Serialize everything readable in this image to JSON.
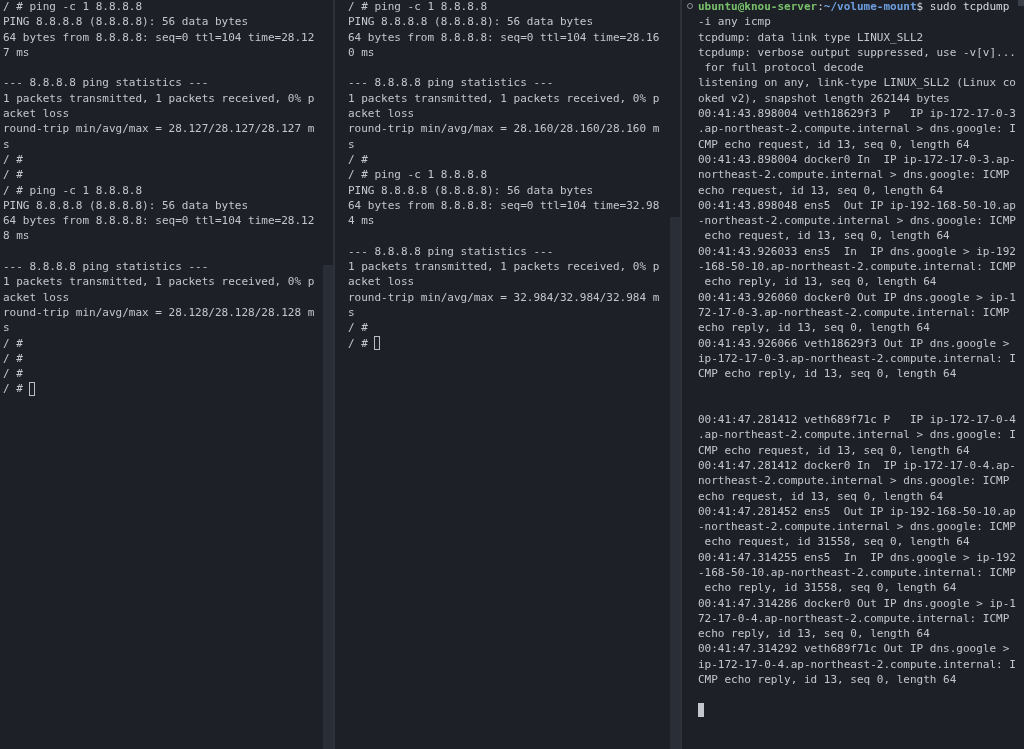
{
  "panes": [
    {
      "focused": false,
      "lines": [
        {
          "kind": "text",
          "text": "/ # ping -c 1 8.8.8.8"
        },
        {
          "kind": "text",
          "text": "PING 8.8.8.8 (8.8.8.8): 56 data bytes"
        },
        {
          "kind": "text",
          "text": "64 bytes from 8.8.8.8: seq=0 ttl=104 time=28.12"
        },
        {
          "kind": "text",
          "text": "7 ms"
        },
        {
          "kind": "blank"
        },
        {
          "kind": "text",
          "text": "--- 8.8.8.8 ping statistics ---"
        },
        {
          "kind": "text",
          "text": "1 packets transmitted, 1 packets received, 0% p"
        },
        {
          "kind": "text",
          "text": "acket loss"
        },
        {
          "kind": "text",
          "text": "round-trip min/avg/max = 28.127/28.127/28.127 m"
        },
        {
          "kind": "text",
          "text": "s"
        },
        {
          "kind": "text",
          "text": "/ #"
        },
        {
          "kind": "text",
          "text": "/ #"
        },
        {
          "kind": "text",
          "text": "/ # ping -c 1 8.8.8.8"
        },
        {
          "kind": "text",
          "text": "PING 8.8.8.8 (8.8.8.8): 56 data bytes"
        },
        {
          "kind": "text",
          "text": "64 bytes from 8.8.8.8: seq=0 ttl=104 time=28.12"
        },
        {
          "kind": "text",
          "text": "8 ms"
        },
        {
          "kind": "blank"
        },
        {
          "kind": "text",
          "text": "--- 8.8.8.8 ping statistics ---"
        },
        {
          "kind": "text",
          "text": "1 packets transmitted, 1 packets received, 0% p"
        },
        {
          "kind": "text",
          "text": "acket loss"
        },
        {
          "kind": "text",
          "text": "round-trip min/avg/max = 28.128/28.128/28.128 m"
        },
        {
          "kind": "text",
          "text": "s"
        },
        {
          "kind": "text",
          "text": "/ #"
        },
        {
          "kind": "text",
          "text": "/ #"
        },
        {
          "kind": "text",
          "text": "/ #"
        },
        {
          "kind": "input",
          "text": "/ #"
        }
      ]
    },
    {
      "focused": false,
      "lines": [
        {
          "kind": "text",
          "text": "/ # ping -c 1 8.8.8.8"
        },
        {
          "kind": "text",
          "text": "PING 8.8.8.8 (8.8.8.8): 56 data bytes"
        },
        {
          "kind": "text",
          "text": "64 bytes from 8.8.8.8: seq=0 ttl=104 time=28.16"
        },
        {
          "kind": "text",
          "text": "0 ms"
        },
        {
          "kind": "blank"
        },
        {
          "kind": "text",
          "text": "--- 8.8.8.8 ping statistics ---"
        },
        {
          "kind": "text",
          "text": "1 packets transmitted, 1 packets received, 0% p"
        },
        {
          "kind": "text",
          "text": "acket loss"
        },
        {
          "kind": "text",
          "text": "round-trip min/avg/max = 28.160/28.160/28.160 m"
        },
        {
          "kind": "text",
          "text": "s"
        },
        {
          "kind": "text",
          "text": "/ #"
        },
        {
          "kind": "text",
          "text": "/ # ping -c 1 8.8.8.8"
        },
        {
          "kind": "text",
          "text": "PING 8.8.8.8 (8.8.8.8): 56 data bytes"
        },
        {
          "kind": "text",
          "text": "64 bytes from 8.8.8.8: seq=0 ttl=104 time=32.98"
        },
        {
          "kind": "text",
          "text": "4 ms"
        },
        {
          "kind": "blank"
        },
        {
          "kind": "text",
          "text": "--- 8.8.8.8 ping statistics ---"
        },
        {
          "kind": "text",
          "text": "1 packets transmitted, 1 packets received, 0% p"
        },
        {
          "kind": "text",
          "text": "acket loss"
        },
        {
          "kind": "text",
          "text": "round-trip min/avg/max = 32.984/32.984/32.984 m"
        },
        {
          "kind": "text",
          "text": "s"
        },
        {
          "kind": "text",
          "text": "/ #"
        },
        {
          "kind": "input",
          "text": "/ #"
        }
      ]
    },
    {
      "focused": true,
      "command_marker": true,
      "lines": [
        {
          "kind": "shell",
          "segments": [
            {
              "kind": "user",
              "text": "ubuntu@knou-server"
            },
            {
              "kind": "plain",
              "text": ":"
            },
            {
              "kind": "path",
              "text": "~/volume-mount"
            },
            {
              "kind": "plain",
              "text": "$ sudo tcpdump"
            }
          ]
        },
        {
          "kind": "text",
          "text": "-i any icmp"
        },
        {
          "kind": "text",
          "text": "tcpdump: data link type LINUX_SLL2"
        },
        {
          "kind": "text",
          "text": "tcpdump: verbose output suppressed, use -v[v]..."
        },
        {
          "kind": "text",
          "text": " for full protocol decode"
        },
        {
          "kind": "text",
          "text": "listening on any, link-type LINUX_SLL2 (Linux co"
        },
        {
          "kind": "text",
          "text": "oked v2), snapshot length 262144 bytes"
        },
        {
          "kind": "text",
          "text": "00:41:43.898004 veth18629f3 P   IP ip-172-17-0-3"
        },
        {
          "kind": "text",
          "text": ".ap-northeast-2.compute.internal > dns.google: I"
        },
        {
          "kind": "text",
          "text": "CMP echo request, id 13, seq 0, length 64"
        },
        {
          "kind": "text",
          "text": "00:41:43.898004 docker0 In  IP ip-172-17-0-3.ap-"
        },
        {
          "kind": "text",
          "text": "northeast-2.compute.internal > dns.google: ICMP"
        },
        {
          "kind": "text",
          "text": "echo request, id 13, seq 0, length 64"
        },
        {
          "kind": "text",
          "text": "00:41:43.898048 ens5  Out IP ip-192-168-50-10.ap"
        },
        {
          "kind": "text",
          "text": "-northeast-2.compute.internal > dns.google: ICMP"
        },
        {
          "kind": "text",
          "text": " echo request, id 13, seq 0, length 64"
        },
        {
          "kind": "text",
          "text": "00:41:43.926033 ens5  In  IP dns.google > ip-192"
        },
        {
          "kind": "text",
          "text": "-168-50-10.ap-northeast-2.compute.internal: ICMP"
        },
        {
          "kind": "text",
          "text": " echo reply, id 13, seq 0, length 64"
        },
        {
          "kind": "text",
          "text": "00:41:43.926060 docker0 Out IP dns.google > ip-1"
        },
        {
          "kind": "text",
          "text": "72-17-0-3.ap-northeast-2.compute.internal: ICMP"
        },
        {
          "kind": "text",
          "text": "echo reply, id 13, seq 0, length 64"
        },
        {
          "kind": "text",
          "text": "00:41:43.926066 veth18629f3 Out IP dns.google >"
        },
        {
          "kind": "text",
          "text": "ip-172-17-0-3.ap-northeast-2.compute.internal: I"
        },
        {
          "kind": "text",
          "text": "CMP echo reply, id 13, seq 0, length 64"
        },
        {
          "kind": "blank"
        },
        {
          "kind": "blank"
        },
        {
          "kind": "text",
          "text": "00:41:47.281412 veth689f71c P   IP ip-172-17-0-4"
        },
        {
          "kind": "text",
          "text": ".ap-northeast-2.compute.internal > dns.google: I"
        },
        {
          "kind": "text",
          "text": "CMP echo request, id 13, seq 0, length 64"
        },
        {
          "kind": "text",
          "text": "00:41:47.281412 docker0 In  IP ip-172-17-0-4.ap-"
        },
        {
          "kind": "text",
          "text": "northeast-2.compute.internal > dns.google: ICMP"
        },
        {
          "kind": "text",
          "text": "echo request, id 13, seq 0, length 64"
        },
        {
          "kind": "text",
          "text": "00:41:47.281452 ens5  Out IP ip-192-168-50-10.ap"
        },
        {
          "kind": "text",
          "text": "-northeast-2.compute.internal > dns.google: ICMP"
        },
        {
          "kind": "text",
          "text": " echo request, id 31558, seq 0, length 64"
        },
        {
          "kind": "text",
          "text": "00:41:47.314255 ens5  In  IP dns.google > ip-192"
        },
        {
          "kind": "text",
          "text": "-168-50-10.ap-northeast-2.compute.internal: ICMP"
        },
        {
          "kind": "text",
          "text": " echo reply, id 31558, seq 0, length 64"
        },
        {
          "kind": "text",
          "text": "00:41:47.314286 docker0 Out IP dns.google > ip-1"
        },
        {
          "kind": "text",
          "text": "72-17-0-4.ap-northeast-2.compute.internal: ICMP"
        },
        {
          "kind": "text",
          "text": "echo reply, id 13, seq 0, length 64"
        },
        {
          "kind": "text",
          "text": "00:41:47.314292 veth689f71c Out IP dns.google >"
        },
        {
          "kind": "text",
          "text": "ip-172-17-0-4.ap-northeast-2.compute.internal: I"
        },
        {
          "kind": "text",
          "text": "CMP echo reply, id 13, seq 0, length 64"
        },
        {
          "kind": "blank"
        },
        {
          "kind": "input"
        }
      ]
    }
  ]
}
